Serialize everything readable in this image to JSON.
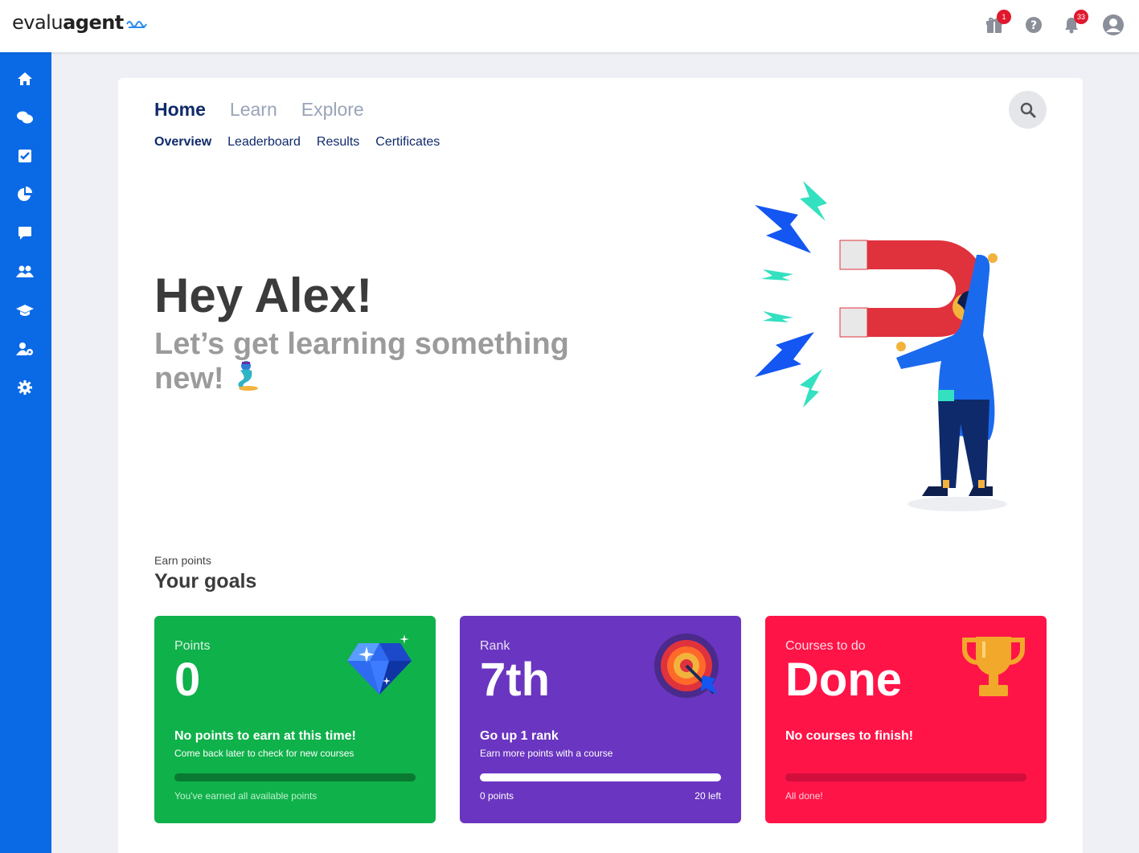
{
  "app": {
    "logo_light": "evalu",
    "logo_bold": "agent",
    "header_icons": [
      {
        "name": "gift-icon",
        "badge": "1"
      },
      {
        "name": "help-icon",
        "badge": ""
      },
      {
        "name": "bell-icon",
        "badge": "33"
      },
      {
        "name": "user-avatar-icon",
        "badge": ""
      }
    ]
  },
  "sidebar": {
    "items": [
      {
        "icon": "home-icon"
      },
      {
        "icon": "chat-bubbles-icon"
      },
      {
        "icon": "checkbox-icon"
      },
      {
        "icon": "pie-chart-icon"
      },
      {
        "icon": "comment-icon"
      },
      {
        "icon": "users-icon"
      },
      {
        "icon": "graduation-cap-icon"
      },
      {
        "icon": "user-settings-icon"
      },
      {
        "icon": "gear-icon"
      }
    ]
  },
  "nav": {
    "tabs": [
      "Home",
      "Learn",
      "Explore"
    ],
    "active_tab": "Home",
    "subtabs": [
      "Overview",
      "Leaderboard",
      "Results",
      "Certificates"
    ],
    "active_subtab": "Overview"
  },
  "hero": {
    "title": "Hey Alex!",
    "subtitle": "Let’s get learning something new!"
  },
  "goals": {
    "overline": "Earn points",
    "title": "Your goals",
    "cards": {
      "points": {
        "label": "Points",
        "value": "0",
        "headline": "No points to earn at this time!",
        "description": "Come back later to check for new courses",
        "progress": 1.0,
        "footer": "You've earned all available points",
        "color": "#0fb14a"
      },
      "rank": {
        "label": "Rank",
        "value": "7th",
        "headline": "Go up 1 rank",
        "description": "Earn more points with a course",
        "progress": 0.0,
        "footer_left": "0 points",
        "footer_right": "20 left",
        "color": "#6a35c0"
      },
      "courses": {
        "label": "Courses to do",
        "value": "Done",
        "headline": "No courses to finish!",
        "progress": 1.0,
        "footer": "All done!",
        "color": "#ff1448"
      }
    }
  },
  "colors": {
    "sidebar": "#0a6ae6",
    "nav_active": "#0f2a6b",
    "badge": "#e0192f"
  }
}
